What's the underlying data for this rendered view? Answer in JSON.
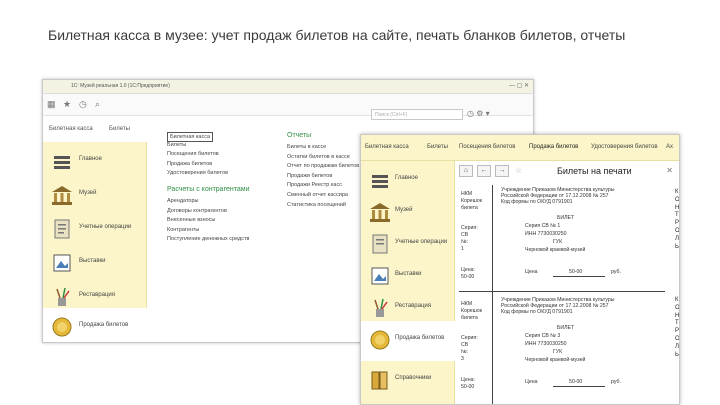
{
  "slide_title": "Билетная касса в музее: учет продаж билетов на сайте, печать бланков билетов, отчеты",
  "back_window": {
    "title": "1С: Музей реальная 1.0 (1С:Предприятие)",
    "search_placeholder": "Поиск (Ctrl+F)",
    "tabs": [
      "Билетная касса",
      "Билеты"
    ],
    "sidebar": [
      {
        "label": "Главное",
        "icon": "gear-icon"
      },
      {
        "label": "Музей",
        "icon": "museum-building-icon"
      },
      {
        "label": "Учетные операции",
        "icon": "document-icon"
      },
      {
        "label": "Выставки",
        "icon": "picture-icon"
      },
      {
        "label": "Реставрация",
        "icon": "brush-icon"
      },
      {
        "label": "Продажа билетов",
        "icon": "coins-icon"
      }
    ],
    "col1": {
      "items": [
        "Билетная касса",
        "Билеты",
        "Посещения билетов",
        "Продажа билетов",
        "Удостоверения билетов"
      ],
      "section": "Расчеты с контрагентами",
      "items2": [
        "Арендаторы",
        "Договоры контрагентов",
        "Внесенные взносы",
        "Контрагенты",
        "Поступление денежных средств"
      ]
    },
    "col2": {
      "header": "Отчеты",
      "items": [
        "Билеты в кассе",
        "Остатки билетов в кассе",
        "Отчет по продажам билетов",
        "Продажи билетов",
        "Продажи Реестр касс",
        "Сменный отчет кассира",
        "Статистика посещений"
      ]
    }
  },
  "front_window": {
    "tabs": [
      "Билетная касса",
      "Билеты",
      "Посещения билетов",
      "Продажа билетов",
      "Удостоверения билетов",
      "Ах"
    ],
    "sidebar": [
      {
        "label": "Главное",
        "icon": "gear-icon"
      },
      {
        "label": "Музей",
        "icon": "museum-building-icon"
      },
      {
        "label": "Учетные операции",
        "icon": "document-icon"
      },
      {
        "label": "Выставки",
        "icon": "picture-icon"
      },
      {
        "label": "Реставрация",
        "icon": "brush-icon"
      },
      {
        "label": "Продажа билетов",
        "icon": "coins-icon"
      },
      {
        "label": "Справочники",
        "icon": "books-icon"
      }
    ],
    "form_title": "Билеты на печати",
    "tickets": [
      {
        "stub": [
          "НКМ",
          "Корешок",
          "билета",
          "",
          "Серия:",
          "СВ",
          "№:",
          "1",
          "",
          "Цена:",
          "50-00"
        ],
        "org": "Учреждение Приказом Министерства культуры",
        "org2": "Российской Федерации от 17.12.2008 № 257",
        "okud": "Код формы по ОКУД 0791901",
        "word": "БИЛЕТ",
        "series_line": "Серия  СВ   №   1",
        "inn": "ИНН   7730030250",
        "org_name": "ГУК",
        "museum": "Черновой краевой-музей",
        "price_label": "Цена",
        "price": "50-00",
        "currency": "руб."
      },
      {
        "stub": [
          "НКМ",
          "Корешок",
          "билета",
          "",
          "Серия:",
          "СВ",
          "№:",
          "3",
          "",
          "Цена:",
          "50-00"
        ],
        "org": "Учреждение Приказом Министерства культуры",
        "org2": "Российской Федерации от 17.12.2008 № 257",
        "okud": "Код формы по ОКУД 0791901",
        "word": "БИЛЕТ",
        "series_line": "Серия  СВ   №   3",
        "inn": "ИНН   7730030250",
        "org_name": "ГУК",
        "museum": "Черновой краевой-музей",
        "price_label": "Цена",
        "price": "50-00",
        "currency": "руб."
      }
    ],
    "control_vertical": [
      "К",
      "О",
      "Н",
      "Т",
      "Р",
      "О",
      "Л",
      "Ь"
    ]
  },
  "colors": {
    "sidebar_bg": "#fbf5c9",
    "section_green": "#2e8f43",
    "slide_title": "#3a3a3a"
  }
}
